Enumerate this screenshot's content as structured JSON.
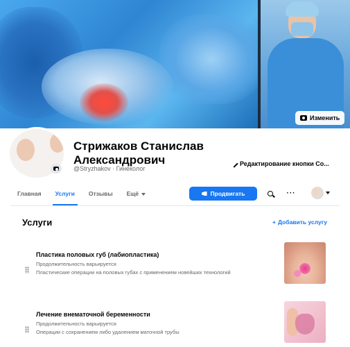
{
  "cover": {
    "change_label": "Изменить"
  },
  "profile": {
    "name": "Стрижаков Станислав Александрович",
    "handle": "@Stryzhakov · Гинеколог",
    "edit_button_label": "Редактирование кнопки Со..."
  },
  "tabs": [
    {
      "label": "Главная",
      "active": false
    },
    {
      "label": "Услуги",
      "active": true
    },
    {
      "label": "Отзывы",
      "active": false
    },
    {
      "label": "Ещё",
      "active": false
    }
  ],
  "actions": {
    "promote_label": "Продвигать",
    "more_label": "···"
  },
  "services": {
    "title": "Услуги",
    "add_label": "Добавить услугу",
    "items": [
      {
        "title": "Пластика половых губ (лабиопластика)",
        "duration": "Продолжительность варьируется",
        "description": "Пластические операции на половых губах с применением новейших технологий"
      },
      {
        "title": "Лечение внематочной беременности",
        "duration": "Продолжительность варьируется",
        "description": "Операции с сохранением либо удалением маточной трубы"
      }
    ]
  },
  "colors": {
    "accent": "#1877f2",
    "text": "#050505",
    "muted": "#65676b"
  },
  "icons": [
    "camera-icon",
    "pencil-icon",
    "megaphone-icon",
    "search-icon",
    "more-icon",
    "chevron-down-icon",
    "plus-icon",
    "drag-handle-icon"
  ]
}
